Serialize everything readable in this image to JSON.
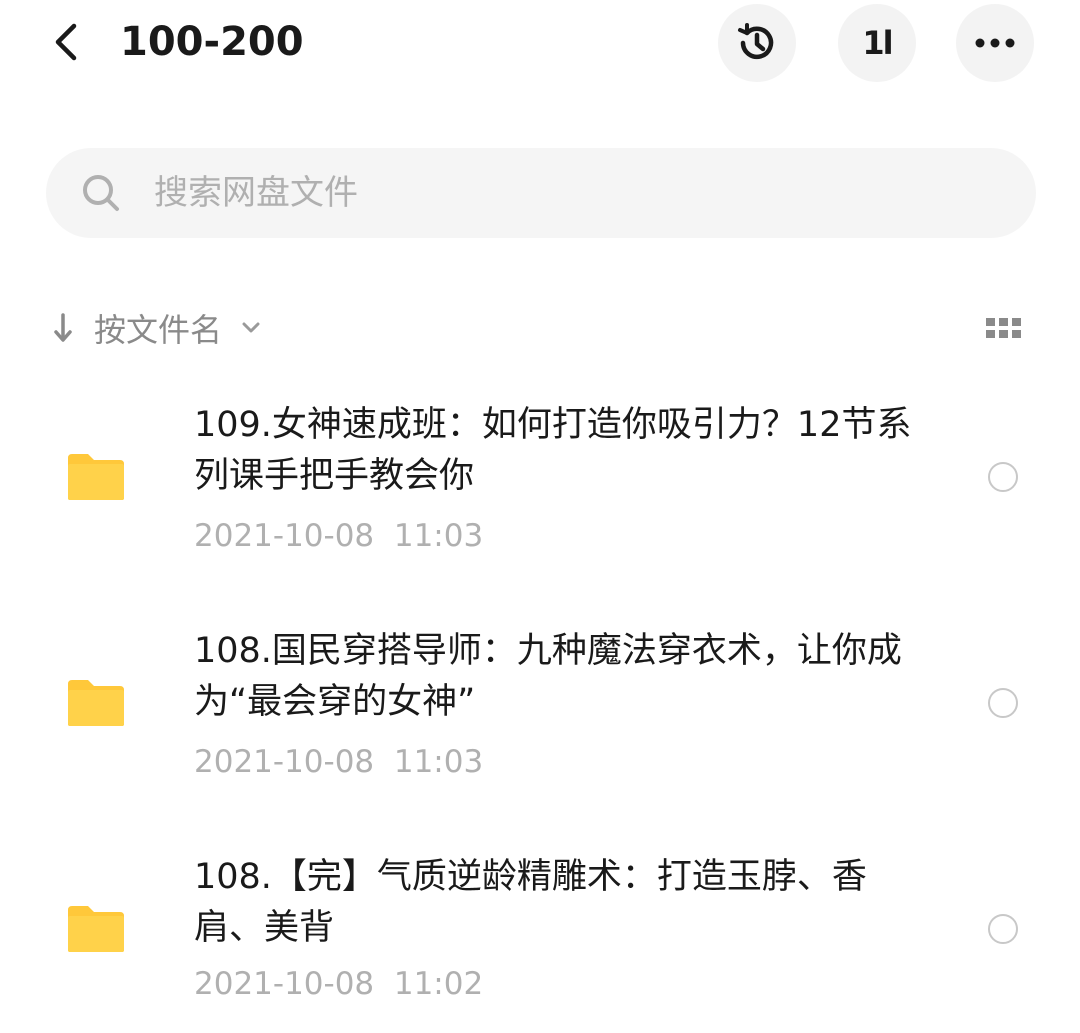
{
  "header": {
    "title": "100-200",
    "back_icon": "chevron-left-icon",
    "actions": [
      {
        "name": "history",
        "icon": "history-icon"
      },
      {
        "name": "sort",
        "icon": "sort-icon",
        "glyph": "1l"
      },
      {
        "name": "more",
        "icon": "more-icon"
      }
    ]
  },
  "search": {
    "placeholder": "搜索网盘文件",
    "value": ""
  },
  "sort": {
    "label": "按文件名",
    "direction_icon": "arrow-down-icon",
    "dropdown_icon": "chevron-down-icon",
    "view_icon": "grid-view-icon"
  },
  "files": [
    {
      "name": "109.女神速成班：如何打造你吸引力？12节系列课手把手教会你",
      "time": "2021-10-08  11:03",
      "icon": "folder-icon"
    },
    {
      "name": "108.国民穿搭导师：九种魔法穿衣术，让你成为“最会穿的女神”",
      "time": "2021-10-08  11:03",
      "icon": "folder-icon"
    },
    {
      "name": "108.【完】气质逆龄精雕术：打造玉脖、香肩、美背",
      "time": "2021-10-08  11:02",
      "icon": "folder-icon"
    }
  ],
  "colors": {
    "folder": "#FFD24A",
    "folder_tab": "#FFC83A",
    "secondary_text": "#b0b0b0",
    "primary_text": "#1a1a1a"
  }
}
